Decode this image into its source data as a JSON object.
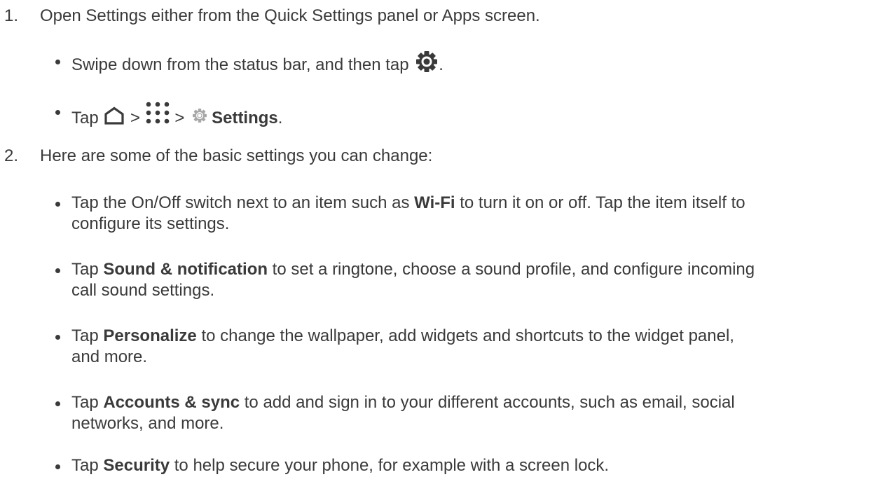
{
  "step1": {
    "number": "1.",
    "text": "Open Settings either from the Quick Settings panel or Apps screen.",
    "bullets": [
      {
        "before": "Swipe down from the status bar, and then tap ",
        "icon": "gear-icon",
        "after": "."
      },
      {
        "before": "Tap ",
        "icon1": "home-icon",
        "sep1": " > ",
        "icon2": "apps-grid-icon",
        "sep2": " > ",
        "icon3": "settings-icon",
        "bold": "Settings",
        "after": "."
      }
    ]
  },
  "step2": {
    "number": "2.",
    "text": "Here are some of the basic settings you can change:",
    "bullets": [
      {
        "line1_before": "Tap the On/Off switch next to an item such as ",
        "line1_bold": "Wi-Fi",
        "line1_after": " to turn it on or off. Tap the item itself to",
        "line2": "configure its settings."
      },
      {
        "line1_before": "Tap ",
        "line1_bold": "Sound & notification",
        "line1_after": " to set a ringtone, choose a sound profile, and configure incoming",
        "line2": "call sound settings."
      },
      {
        "line1_before": "Tap ",
        "line1_bold": "Personalize",
        "line1_after": " to change the wallpaper, add widgets and shortcuts to the widget panel,",
        "line2": "and more."
      },
      {
        "line1_before": "Tap ",
        "line1_bold": "Accounts & sync",
        "line1_after": " to add and sign in to your different accounts, such as email, social",
        "line2": "networks, and more."
      },
      {
        "line1_before": "Tap ",
        "line1_bold": "Security",
        "line1_after": " to help secure your phone, for example with a screen lock."
      }
    ]
  }
}
